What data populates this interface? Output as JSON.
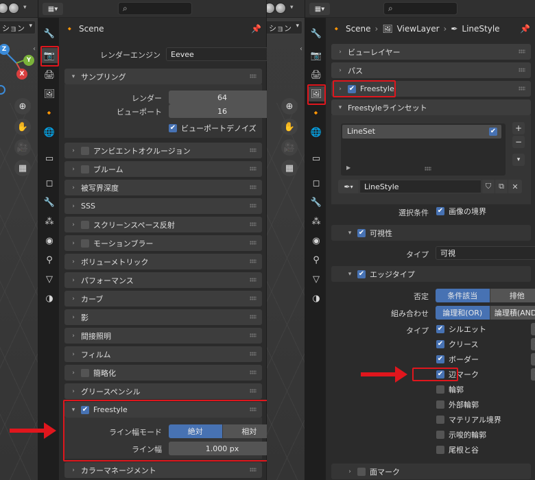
{
  "left_viewport": {
    "mode_label": "ション",
    "gizmo_axes": {
      "x": "X",
      "y": "Y",
      "z": "Z"
    }
  },
  "render_panel": {
    "search_placeholder": "",
    "context": "Scene",
    "render_engine_label": "レンダーエンジン",
    "render_engine_value": "Eevee",
    "sampling": {
      "title": "サンプリング",
      "render_label": "レンダー",
      "render_value": "64",
      "viewport_label": "ビューポート",
      "viewport_value": "16",
      "viewport_denoise_label": "ビューポートデノイズ"
    },
    "panels": [
      {
        "label": "アンビエントオクルージョン",
        "checkbox": true,
        "checked": false
      },
      {
        "label": "ブルーム",
        "checkbox": true,
        "checked": false
      },
      {
        "label": "被写界深度",
        "checkbox": false
      },
      {
        "label": "SSS",
        "checkbox": false
      },
      {
        "label": "スクリーンスペース反射",
        "checkbox": true,
        "checked": false
      },
      {
        "label": "モーションブラー",
        "checkbox": true,
        "checked": false
      },
      {
        "label": "ボリューメトリック",
        "checkbox": false
      },
      {
        "label": "パフォーマンス",
        "checkbox": false
      },
      {
        "label": "カーブ",
        "checkbox": false
      },
      {
        "label": "影",
        "checkbox": false
      },
      {
        "label": "間接照明",
        "checkbox": false
      },
      {
        "label": "フィルム",
        "checkbox": false
      },
      {
        "label": "簡略化",
        "checkbox": true,
        "checked": false
      },
      {
        "label": "グリースペンシル",
        "checkbox": false
      }
    ],
    "freestyle": {
      "title": "Freestyle",
      "line_width_mode_label": "ライン幅モード",
      "mode_options": [
        "絶対",
        "相対"
      ],
      "line_width_label": "ライン幅",
      "line_width_value": "1.000 px"
    },
    "color_management": "カラーマネージメント"
  },
  "viewlayer_panel": {
    "breadcrumb": [
      "Scene",
      "ViewLayer",
      "LineStyle"
    ],
    "view_layer_panel": "ビューレイヤー",
    "passes_panel": "パス",
    "freestyle_panel": "Freestyle",
    "lineset_panel": "Freestyleラインセット",
    "lineset_item": "LineSet",
    "linestyle_name": "LineStyle",
    "selection_label": "選択条件",
    "image_border_label": "画像の境界",
    "visibility": {
      "title": "可視性",
      "type_label": "タイプ",
      "type_value": "可視"
    },
    "edge_types": {
      "title": "エッジタイプ",
      "negation_label": "否定",
      "negation_options": [
        "条件該当",
        "排他"
      ],
      "combination_label": "組み合わせ",
      "combination_options": [
        "論理和(OR)",
        "論理積(AND)"
      ],
      "type_label": "タイプ",
      "items": [
        {
          "label": "シルエット",
          "checked": true
        },
        {
          "label": "クリース",
          "checked": true
        },
        {
          "label": "ボーダー",
          "checked": true
        },
        {
          "label": "辺マーク",
          "checked": true
        },
        {
          "label": "輪郭",
          "checked": false
        },
        {
          "label": "外部輪郭",
          "checked": false
        },
        {
          "label": "マテリアル境界",
          "checked": false
        },
        {
          "label": "示唆的輪郭",
          "checked": false
        },
        {
          "label": "尾根と谷",
          "checked": false
        }
      ]
    },
    "face_marks": "面マーク"
  },
  "colors": {
    "accent": "#4772b3",
    "highlight": "#e0161d"
  }
}
